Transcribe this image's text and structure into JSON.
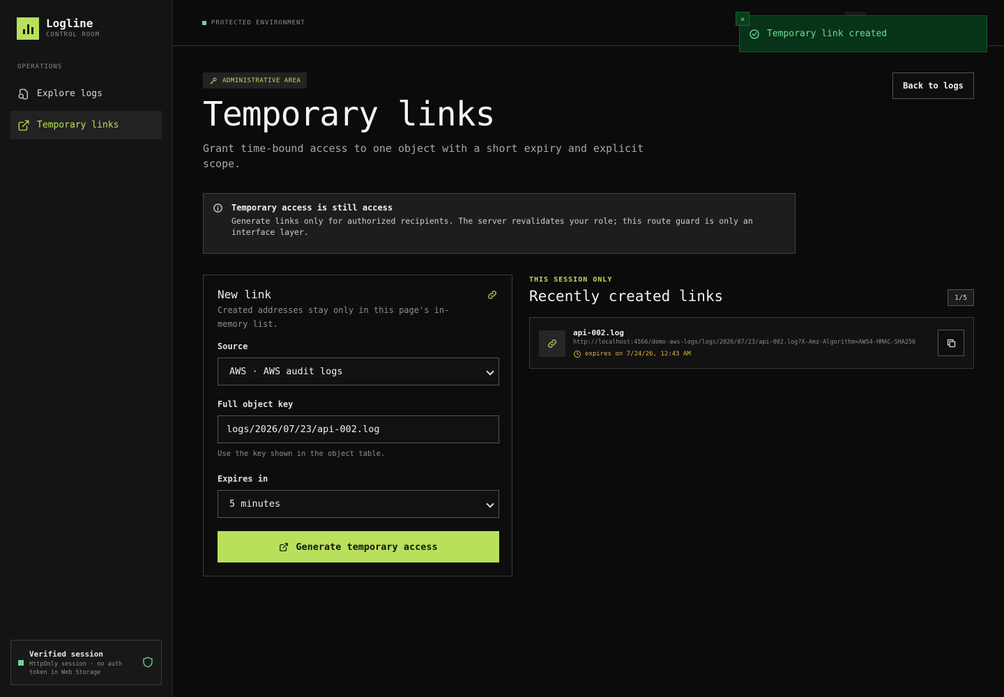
{
  "brand": {
    "name": "Logline",
    "subtitle": "CONTROL ROOM"
  },
  "sidebar": {
    "heading": "OPERATIONS",
    "items": [
      {
        "label": "Explore logs",
        "icon": "explore-logs-icon",
        "active": false
      },
      {
        "label": "Temporary links",
        "icon": "external-link-icon",
        "active": true
      }
    ],
    "session": {
      "title": "Verified session",
      "subtitle": "HttpOnly session · no auth token in Web Storage",
      "icon": "shield-icon"
    }
  },
  "topbar": {
    "environment": "PROTECTED ENVIRONMENT"
  },
  "toast": {
    "message": "Temporary link created",
    "close": "×",
    "icon": "check-circle-icon"
  },
  "page": {
    "badge": "ADMINISTRATIVE AREA",
    "title": "Temporary links",
    "description": "Grant time-bound access to one object with a short expiry and explicit scope.",
    "back_button": "Back to logs"
  },
  "notice": {
    "title": "Temporary access is still access",
    "body": "Generate links only for authorized recipients. The server revalidates your role; this route guard is only an interface layer."
  },
  "form": {
    "title": "New link",
    "subtitle": "Created addresses stay only in this page's in-memory list.",
    "source_label": "Source",
    "source_value": "AWS · AWS audit logs",
    "key_label": "Full object key",
    "key_value": "logs/2026/07/23/api-002.log",
    "key_hint": "Use the key shown in the object table.",
    "expires_label": "Expires in",
    "expires_value": "5 minutes",
    "submit": "Generate temporary access"
  },
  "recent": {
    "kicker": "THIS SESSION ONLY",
    "title": "Recently created links",
    "count": "1/5",
    "links": [
      {
        "name": "api-002.log",
        "url": "http://localhost:4566/demo-aws-logs/logs/2026/07/23/api-002.log?X-Amz-Algorithm=AWS4-HMAC-SHA256",
        "expires": "expires on 7/24/26, 12:43 AM"
      }
    ]
  },
  "colors": {
    "accent": "#b8e05a",
    "success": "#6fdc97",
    "warning": "#e8b23a",
    "background": "#0b0b0b",
    "sidebar": "#141414"
  }
}
